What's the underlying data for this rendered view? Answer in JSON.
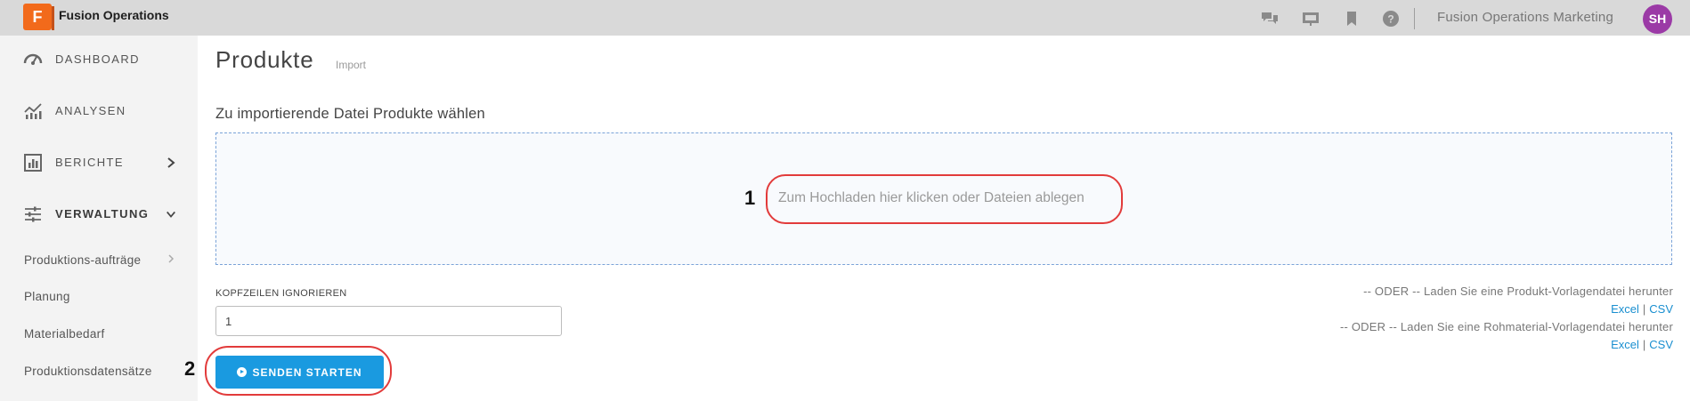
{
  "header": {
    "logo_letter": "F",
    "app_title": "Fusion Operations",
    "org_name": "Fusion Operations Marketing",
    "avatar_initials": "SH",
    "icons": [
      "chat-icon",
      "presentation-icon",
      "bookmark-icon",
      "help-icon"
    ]
  },
  "sidebar": {
    "items": [
      {
        "label": "DASHBOARD",
        "icon": "gauge-icon"
      },
      {
        "label": "ANALYSEN",
        "icon": "analytics-icon"
      },
      {
        "label": "BERICHTE",
        "icon": "reports-icon"
      },
      {
        "label": "VERWALTUNG",
        "icon": "sliders-icon"
      }
    ],
    "sub_items": [
      {
        "label": "Produktions-aufträge"
      },
      {
        "label": "Planung"
      },
      {
        "label": "Materialbedarf"
      },
      {
        "label": "Produktionsdatensätze"
      }
    ]
  },
  "main": {
    "title": "Produkte",
    "subtitle": "Import",
    "section_title": "Zu importierende Datei Produkte wählen",
    "dropzone_text": "Zum Hochladen hier klicken oder Dateien ablegen",
    "header_rows_label": "KOPFZEILEN IGNORIEREN",
    "header_rows_value": "1",
    "start_button": "SENDEN STARTEN",
    "template_product_text": "-- ODER -- Laden Sie eine Produkt-Vorlagendatei herunter",
    "template_material_text": "-- ODER -- Laden Sie eine Rohmaterial-Vorlagendatei herunter",
    "excel_label": "Excel",
    "csv_label": "CSV",
    "link_separator": "|"
  },
  "annotations": {
    "label_1": "1",
    "label_2": "2"
  },
  "colors": {
    "accent": "#1a9ae0",
    "logo": "#f26a1b",
    "avatar": "#9b3aa6",
    "annotation": "#e23b3b"
  }
}
